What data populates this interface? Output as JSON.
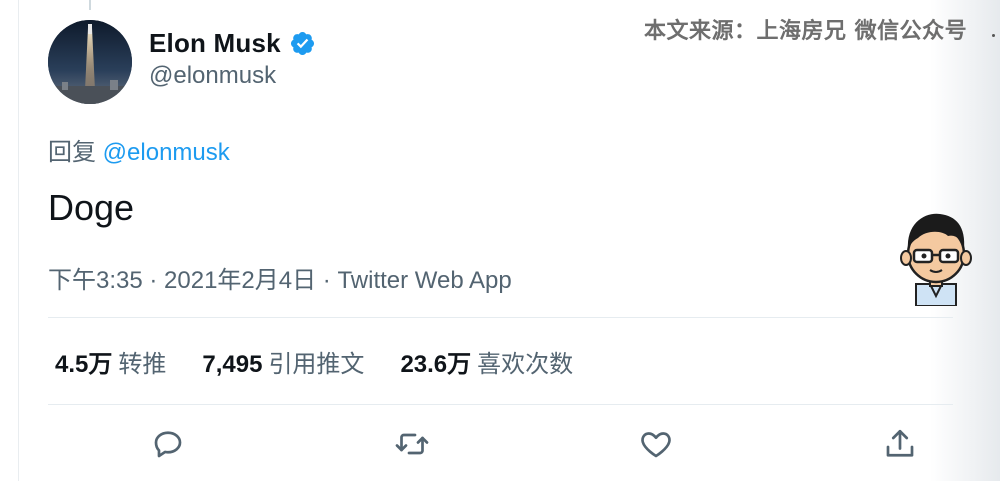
{
  "author": {
    "display_name": "Elon Musk",
    "handle": "@elonmusk",
    "verified": true
  },
  "watermark": "本文来源：上海房兄 微信公众号",
  "reply": {
    "prefix": "回复",
    "mention": "@elonmusk"
  },
  "tweet": {
    "text": "Doge",
    "meta": "下午3:35 · 2021年2月4日 · Twitter Web App"
  },
  "stats": [
    {
      "value": "4.5万",
      "label": "转推"
    },
    {
      "value": "7,495",
      "label": "引用推文"
    },
    {
      "value": "23.6万",
      "label": "喜欢次数"
    }
  ],
  "actions": [
    {
      "icon": "reply-icon"
    },
    {
      "icon": "retweet-icon"
    },
    {
      "icon": "like-icon"
    },
    {
      "icon": "share-icon"
    }
  ],
  "colors": {
    "link": "#1d9bf0",
    "secondary_text": "#536471",
    "primary_text": "#0f1419"
  }
}
